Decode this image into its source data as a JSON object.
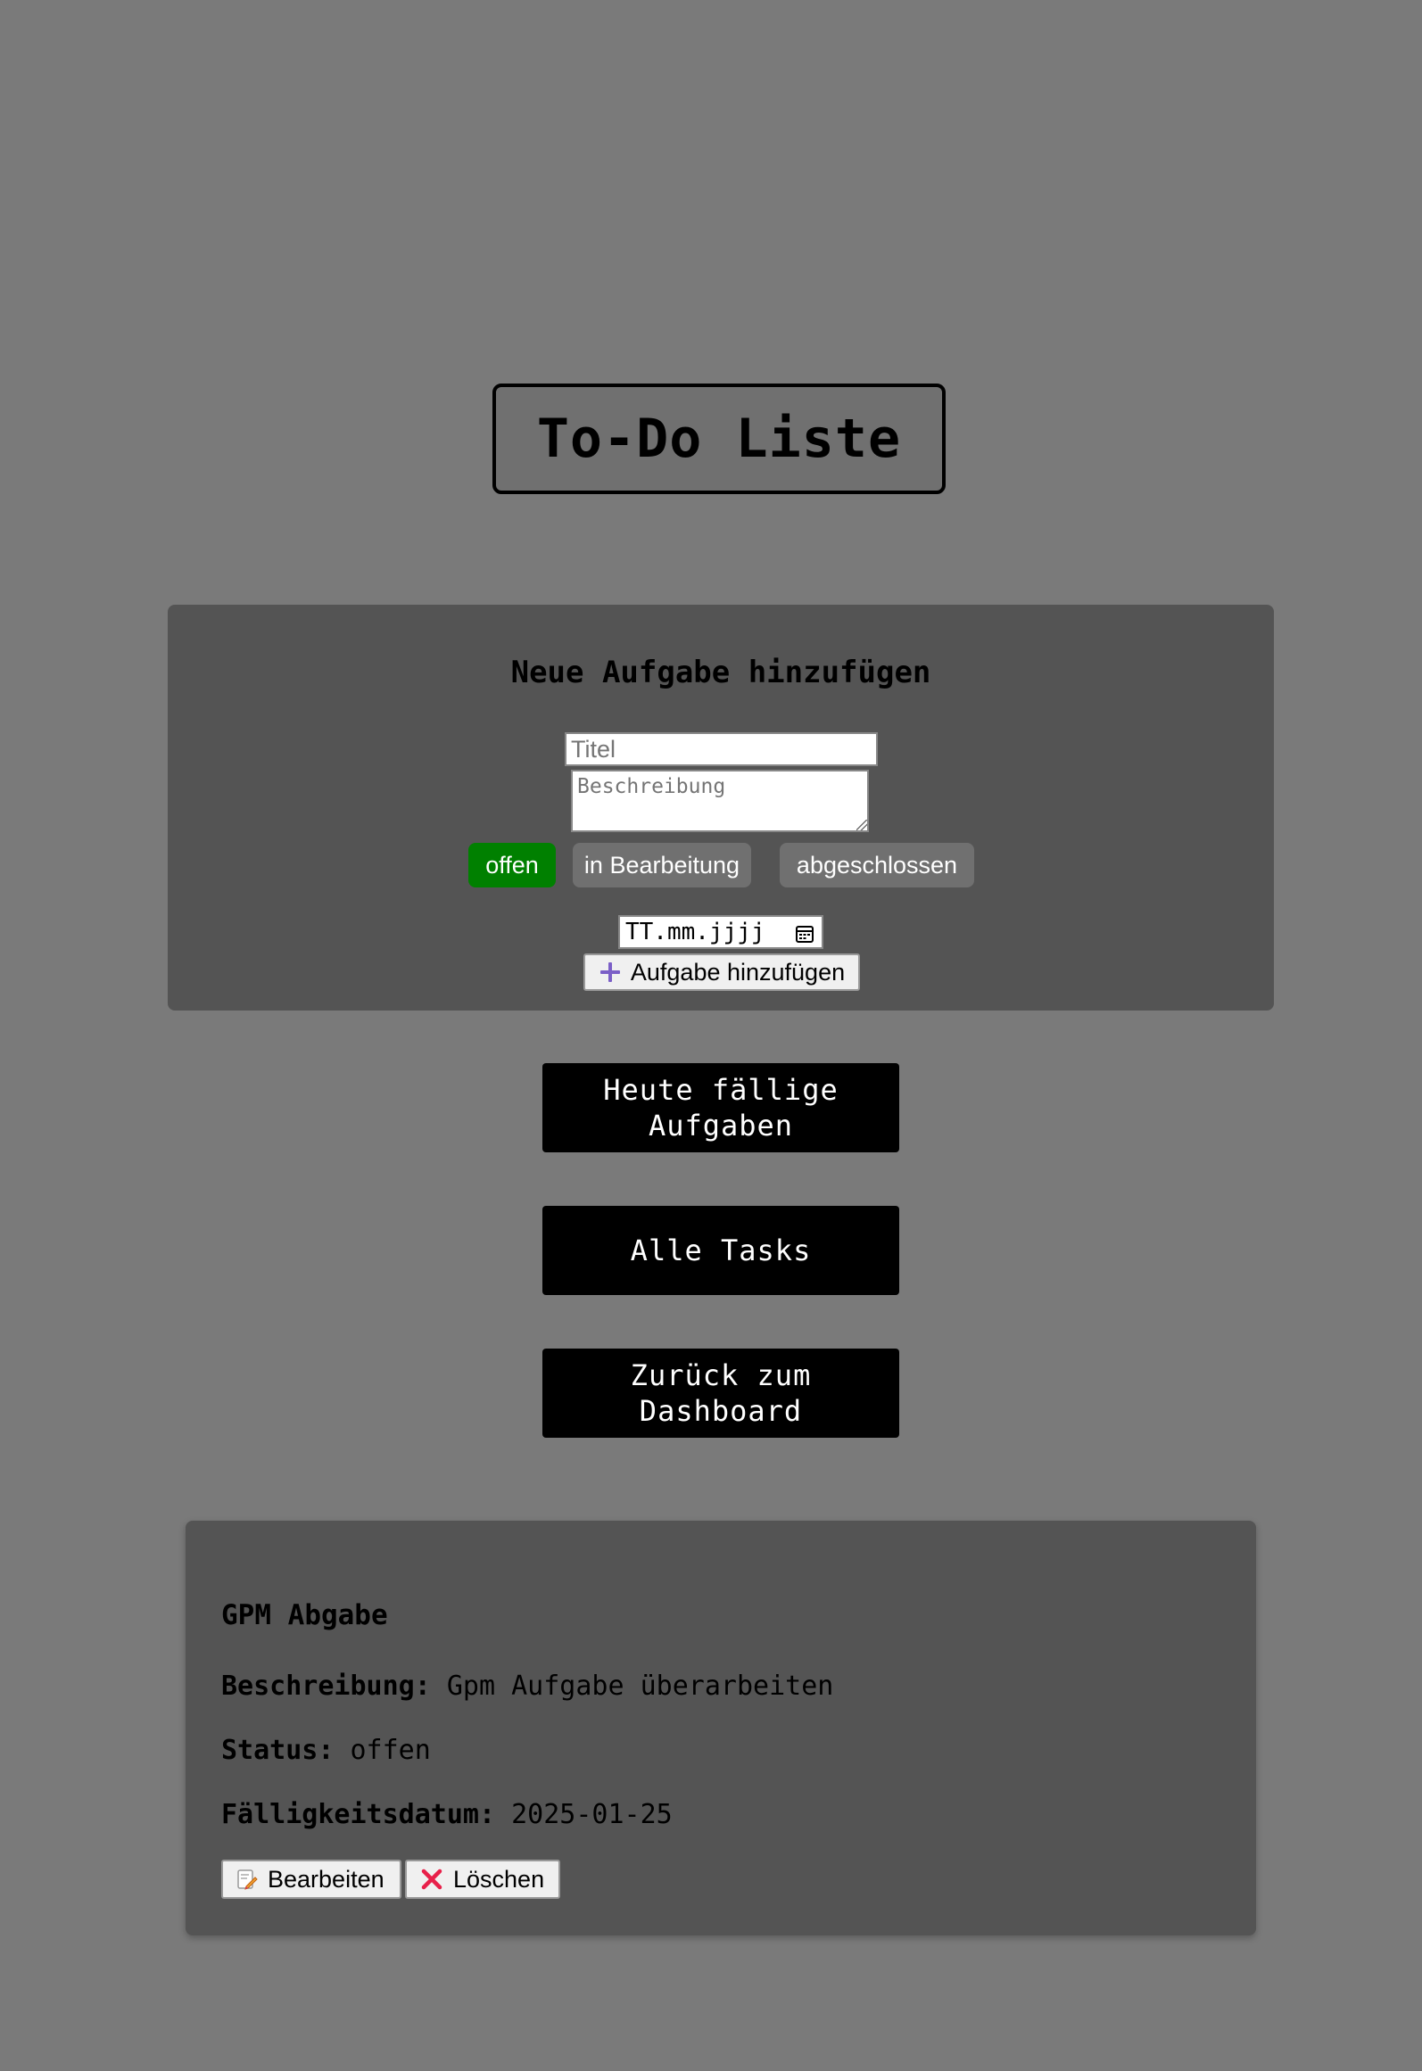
{
  "header": {
    "title": "To-Do Liste"
  },
  "form": {
    "heading": "Neue Aufgabe hinzufügen",
    "title_placeholder": "Titel",
    "description_placeholder": "Beschreibung",
    "status_options": [
      "offen",
      "in Bearbeitung",
      "abgeschlossen"
    ],
    "selected_status": "offen",
    "date_placeholder": "TT.mm.jjjj",
    "add_button_label": "Aufgabe hinzufügen",
    "add_icon": "plus-icon"
  },
  "nav": {
    "today_label": "Heute fällige Aufgaben",
    "all_label": "Alle Tasks",
    "back_label": "Zurück zum Dashboard"
  },
  "task": {
    "title": "GPM Abgabe",
    "description_label": "Beschreibung:",
    "description": "Gpm Aufgabe überarbeiten",
    "status_label": "Status:",
    "status": "offen",
    "due_label": "Fälligkeitsdatum:",
    "due": "2025-01-25",
    "edit_label": "Bearbeiten",
    "edit_icon": "memo-pencil-icon",
    "delete_label": "Löschen",
    "delete_icon": "cross-mark-icon"
  },
  "colors": {
    "page_bg": "#7a7a7a",
    "card_bg": "#545454",
    "active_status": "#008000",
    "inactive_status": "#707070",
    "nav_button": "#000000"
  }
}
